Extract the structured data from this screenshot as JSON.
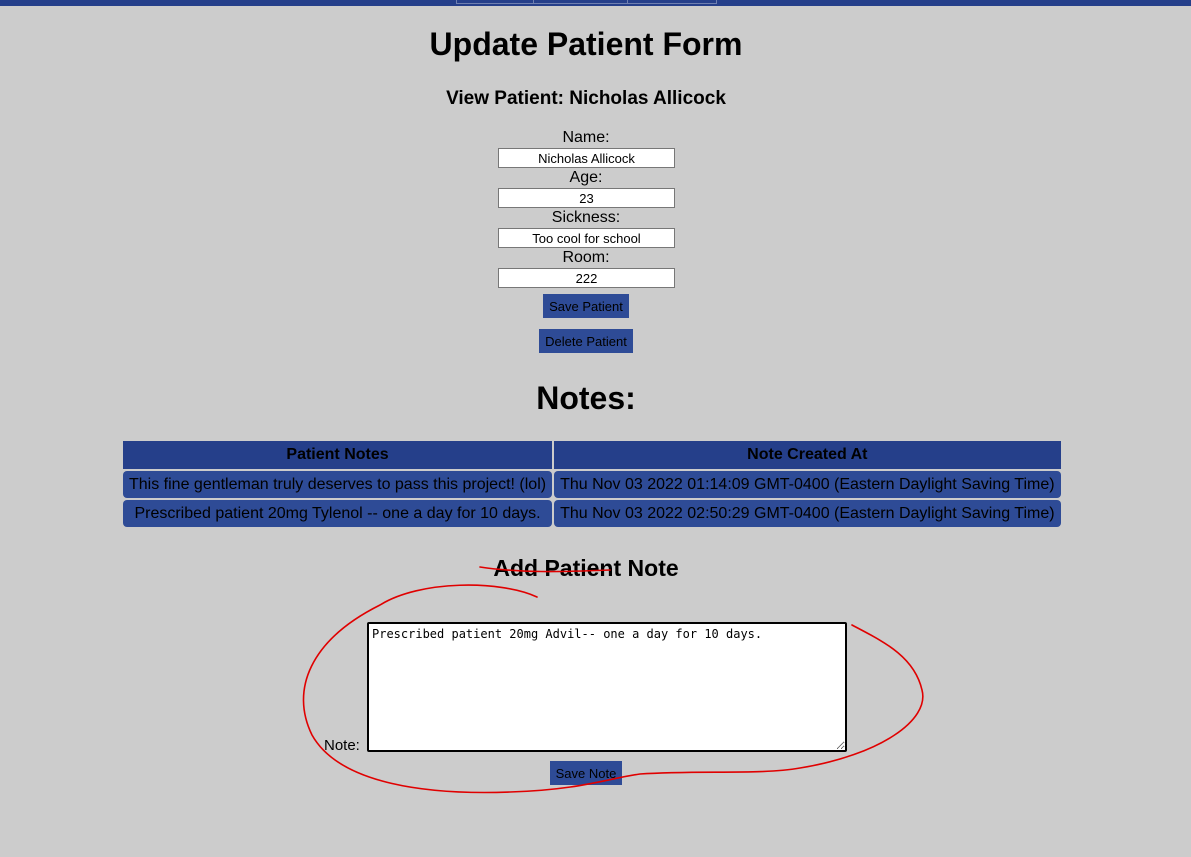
{
  "page": {
    "title": "Update Patient Form",
    "subtitle": "View Patient: Nicholas Allicock"
  },
  "form": {
    "name_label": "Name:",
    "name_value": "Nicholas Allicock",
    "age_label": "Age:",
    "age_value": "23",
    "sickness_label": "Sickness:",
    "sickness_value": "Too cool for school",
    "room_label": "Room:",
    "room_value": "222",
    "save_label": "Save Patient",
    "delete_label": "Delete Patient"
  },
  "notes": {
    "heading": "Notes:",
    "columns": [
      "Patient Notes",
      "Note Created At"
    ],
    "rows": [
      [
        "This fine gentleman truly deserves to pass this project! (lol)",
        "Thu Nov 03 2022 01:14:09 GMT-0400 (Eastern Daylight Saving Time)"
      ],
      [
        "Prescribed patient 20mg Tylenol -- one a day for 10 days.",
        "Thu Nov 03 2022 02:50:29 GMT-0400 (Eastern Daylight Saving Time)"
      ]
    ]
  },
  "add_note": {
    "heading": "Add Patient Note",
    "label": "Note:",
    "value": "Prescribed patient 20mg Advil-- one a day for 10 days.",
    "save_label": "Save Note"
  },
  "colors": {
    "background": "#cccccc",
    "header_blue": "#253f8a",
    "button_blue": "#2e4b96",
    "annotation_red": "#e00000"
  }
}
